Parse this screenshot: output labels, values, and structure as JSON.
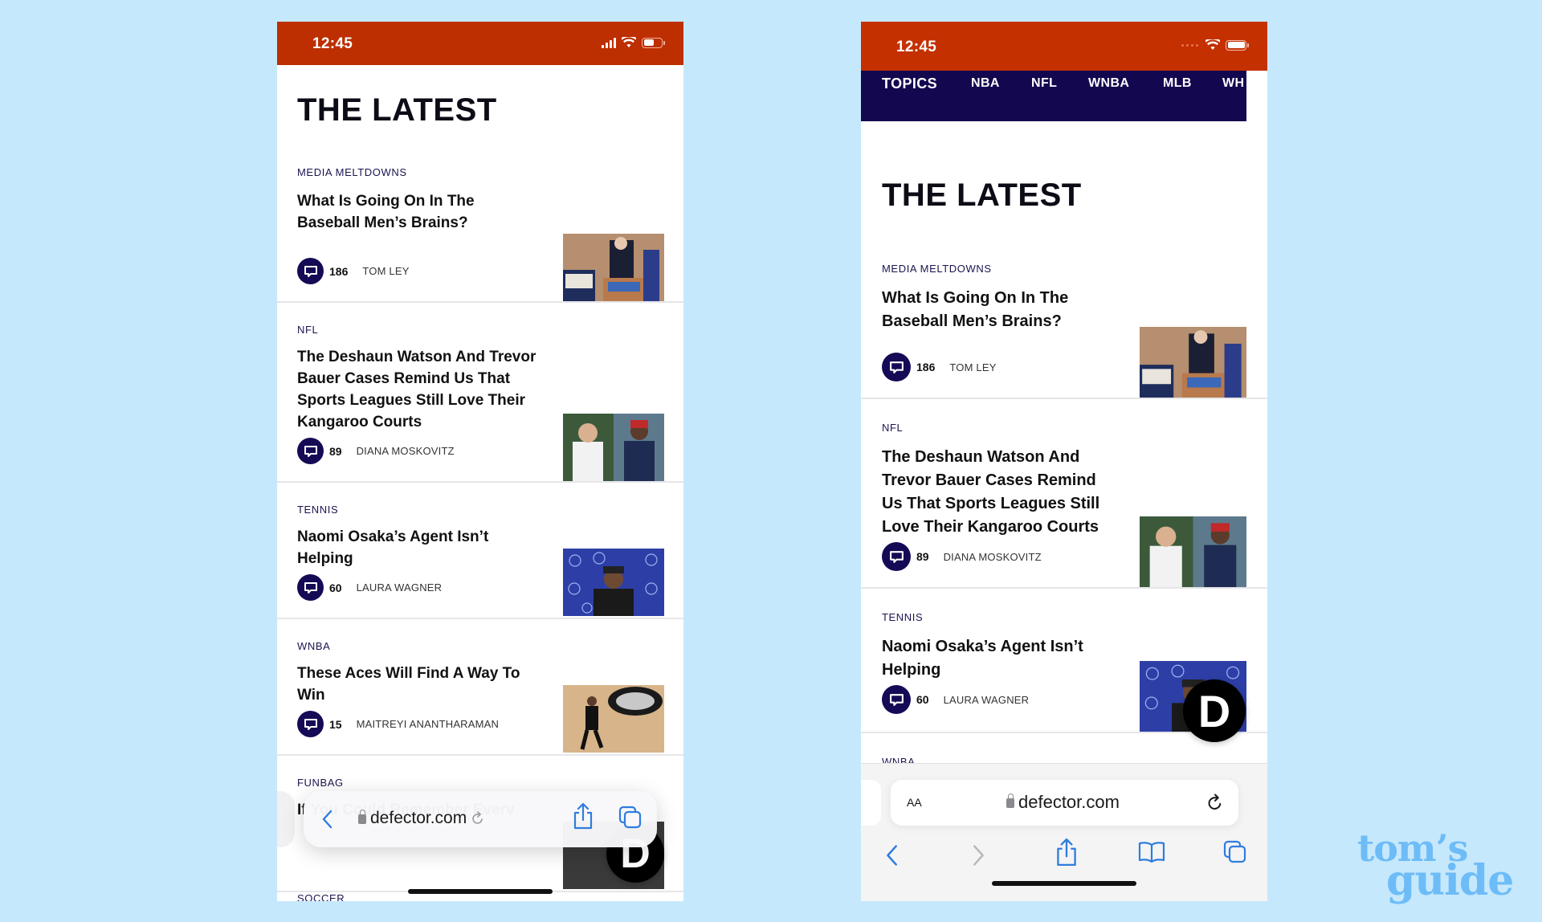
{
  "left_phone": {
    "status_time": "12:45",
    "page_title": "THE LATEST",
    "articles": [
      {
        "category": "MEDIA MELTDOWNS",
        "title": "What Is Going On In The Baseball Men’s Brains?",
        "comments": "186",
        "author": "TOM LEY"
      },
      {
        "category": "NFL",
        "title": "The Deshaun Watson And Trevor Bauer Cases Remind Us That Sports Leagues Still Love Their Kangaroo Courts",
        "comments": "89",
        "author": "DIANA MOSKOVITZ"
      },
      {
        "category": "TENNIS",
        "title": "Naomi Osaka’s Agent Isn’t Helping",
        "comments": "60",
        "author": "LAURA WAGNER"
      },
      {
        "category": "WNBA",
        "title": "These Aces Will Find A Way To Win",
        "comments": "15",
        "author": "MAITREYI ANANTHARAMAN"
      },
      {
        "category": "FUNBAG",
        "title": "If You Could Remember Every S…",
        "comments": "",
        "author": ""
      },
      {
        "category": "SOCCER"
      }
    ],
    "url_bar": {
      "url": "defector.com"
    },
    "fab_label": "D"
  },
  "right_phone": {
    "status_time": "12:45",
    "topics_nav": [
      "TOPICS",
      "NBA",
      "NFL",
      "WNBA",
      "MLB",
      "WH"
    ],
    "page_title": "THE LATEST",
    "articles": [
      {
        "category": "MEDIA MELTDOWNS",
        "title": "What Is Going On In The Baseball Men’s Brains?",
        "comments": "186",
        "author": "TOM LEY"
      },
      {
        "category": "NFL",
        "title": "The Deshaun Watson And Trevor Bauer Cases Remind Us That Sports Leagues Still Love Their Kangaroo Courts",
        "comments": "89",
        "author": "DIANA MOSKOVITZ"
      },
      {
        "category": "TENNIS",
        "title": "Naomi Osaka’s Agent Isn’t Helping",
        "comments": "60",
        "author": "LAURA WAGNER"
      },
      {
        "category": "WNBA"
      }
    ],
    "url_bar": {
      "text_size_label": "AA",
      "url": "defector.com"
    },
    "fab_label": "D"
  },
  "watermark": {
    "line1": "tom’s",
    "line2": "guide"
  },
  "colors": {
    "status_bar": "#bd2e00",
    "nav_band": "#13074f",
    "comment_bubble": "#150a55",
    "ios_blue": "#2f7ddc",
    "background": "#c6e8fc"
  }
}
